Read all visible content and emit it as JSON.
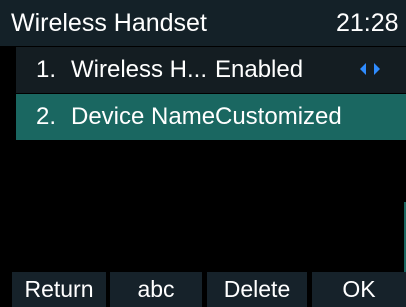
{
  "header": {
    "title": "Wireless Handset",
    "clock": "21:28"
  },
  "list": {
    "items": [
      {
        "number": "1.",
        "label": "Wireless H...",
        "value": "Enabled",
        "control": "left-right-arrows-icon"
      },
      {
        "number": "2.",
        "label": "Device Name",
        "value": "Customized"
      }
    ]
  },
  "softkeys": [
    "Return",
    "abc",
    "Delete",
    "OK"
  ],
  "colors": {
    "titlebar": "#142128",
    "selected_row": "#1a6761",
    "unselected_row": "#141d22",
    "arrow_accent": "#2f8cff"
  }
}
